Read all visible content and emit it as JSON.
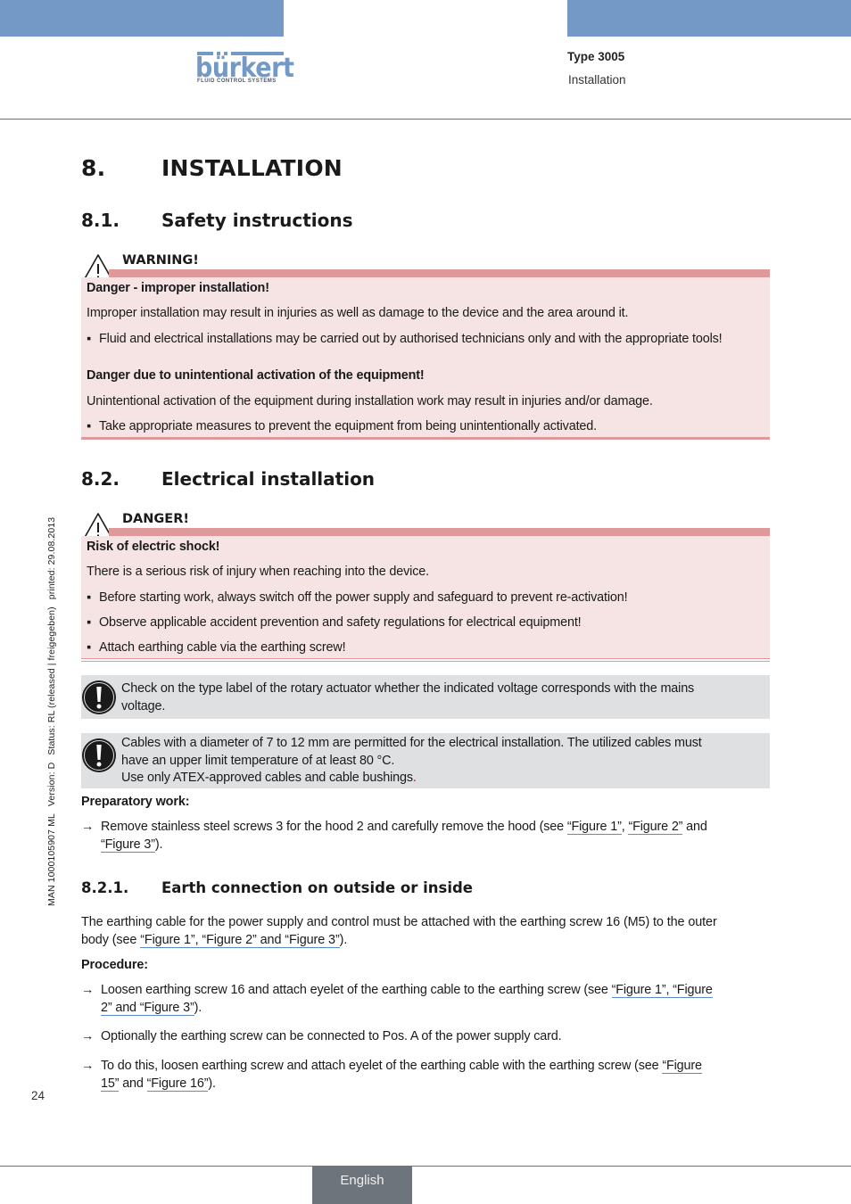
{
  "header": {
    "brand_name": "bürkert",
    "brand_tagline": "FLUID CONTROL SYSTEMS",
    "doc_type": "Type 3005",
    "doc_section": "Installation",
    "accent_color": "#7499c6"
  },
  "side_meta": {
    "man": "MAN  1000105907  ML",
    "version": "Version: D",
    "status": "Status: RL (released | freigegeben)",
    "printed": "printed: 29.08.2013"
  },
  "chapter": {
    "number": "8.",
    "title": "INSTALLATION"
  },
  "sections": {
    "safety": {
      "number": "8.1.",
      "title": "Safety instructions",
      "warning": {
        "icon": "warning-triangle-icon",
        "signal_word": "WARNING!",
        "color": "#e0999b",
        "background": "#f5e4e3",
        "heading1": "Danger - improper installation!",
        "text1": "Improper installation may result in injuries as well as damage to the device and the area around it.",
        "bullet1": "Fluid and electrical installations may be carried out by authorised technicians only and with the appropriate tools!",
        "heading2": "Danger due to unintentional activation of the equipment!",
        "text2": "Unintentional activation of the equipment during installation work may result in injuries and/or damage.",
        "bullet2": "Take appropriate measures to prevent the equipment from being unintentionally activated."
      }
    },
    "electrical": {
      "number": "8.2.",
      "title": "Electrical installation",
      "danger": {
        "icon": "warning-triangle-icon",
        "signal_word": "DANGER!",
        "heading": "Risk of electric shock!",
        "text": "There is a serious risk of injury when reaching into the device.",
        "bullets": [
          "Before starting work, always switch off the power supply and safeguard to prevent re-activation!",
          "Observe applicable accident prevention and safety regulations for electrical equipment!",
          "Attach earthing cable via the earthing screw!"
        ]
      },
      "note1": {
        "icon": "exclamation-circle-icon",
        "line1": "Check on the type label of the rotary actuator whether the indicated voltage corresponds with the mains",
        "line2": "voltage."
      },
      "note2": {
        "icon": "exclamation-circle-icon",
        "line1": "Cables with a diameter of 7 to 12 mm are permitted for the electrical installation. The utilized cables must",
        "line2": "have an upper limit temperature of at least 80 °C.",
        "line3": "Use only ATEX-approved cables and cable bushings",
        "line3_end": "."
      },
      "prep_label": "Preparatory work:",
      "prep_step": {
        "arrow": "→",
        "text_a": "Remove stainless steel screws 3 for the hood 2 and carefully remove the hood (see ",
        "link1": "“Figure 1”",
        "sep1": ", ",
        "link2": "“Figure 2”",
        "sep2": " and",
        "link3": "“Figure 3”",
        "text_b": ")."
      }
    },
    "earth": {
      "number": "8.2.1.",
      "title": "Earth connection on outside or inside",
      "intro_a": "The earthing cable for the power supply and control must be attached with the earthing screw 16 (M5) to the outer",
      "intro_b": "body (see ",
      "intro_link": "“Figure 1”, “Figure 2” and “Figure 3”",
      "intro_c": ").",
      "procedure_label": "Procedure:",
      "steps": [
        {
          "arrow": "→",
          "text_a": "Loosen earthing screw 16 and attach eyelet of the earthing cable to the earthing screw (see ",
          "link_a": "“Figure 1”, “Figure",
          "link_b": "2” and “Figure 3”",
          "text_b": ")."
        },
        {
          "arrow": "→",
          "text_a": "Optionally the earthing screw can be connected to Pos. A of the power supply card."
        },
        {
          "arrow": "→",
          "text_a": "To do this, loosen earthing screw and attach eyelet of the earthing cable with the earthing screw (see ",
          "link_a": "“Figure",
          "link_b": "15”",
          "mid": " and ",
          "link_c": "“Figure 16”",
          "text_b": ")."
        }
      ]
    }
  },
  "footer": {
    "page_number": "24",
    "language": "English"
  }
}
